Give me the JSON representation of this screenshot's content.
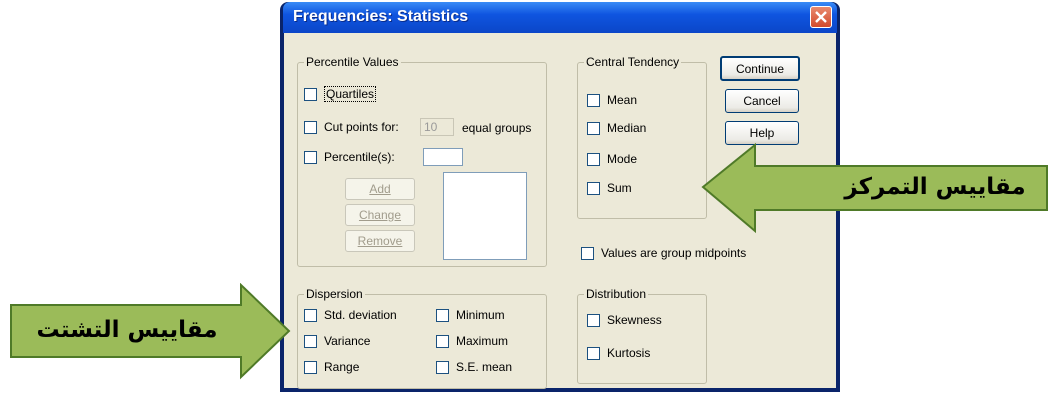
{
  "window": {
    "title": "Frequencies: Statistics"
  },
  "percentile_values": {
    "legend": "Percentile Values",
    "quartiles": "Quartiles",
    "cut_points_label": "Cut points for:",
    "cut_points_value": "10",
    "equal_groups": "equal groups",
    "percentiles_label": "Percentile(s):",
    "add": "Add",
    "change": "Change",
    "remove": "Remove"
  },
  "central_tendency": {
    "legend": "Central Tendency",
    "mean": "Mean",
    "median": "Median",
    "mode": "Mode",
    "sum": "Sum"
  },
  "buttons": {
    "continue": "Continue",
    "cancel": "Cancel",
    "help": "Help"
  },
  "values_group_midpoints": "Values are group midpoints",
  "dispersion": {
    "legend": "Dispersion",
    "std_deviation": "Std. deviation",
    "variance": "Variance",
    "range": "Range",
    "minimum": "Minimum",
    "maximum": "Maximum",
    "se_mean": "S.E. mean"
  },
  "distribution": {
    "legend": "Distribution",
    "skewness": "Skewness",
    "kurtosis": "Kurtosis"
  },
  "callouts": {
    "central_tendency_label": "مقاييس التمركز",
    "dispersion_label": "مقاييس التشتت"
  },
  "colors": {
    "callout_fill": "#9bbb59",
    "callout_border": "#4f7a28",
    "titlebar": "#0f55e0"
  },
  "icons": {
    "close": "close-icon"
  }
}
